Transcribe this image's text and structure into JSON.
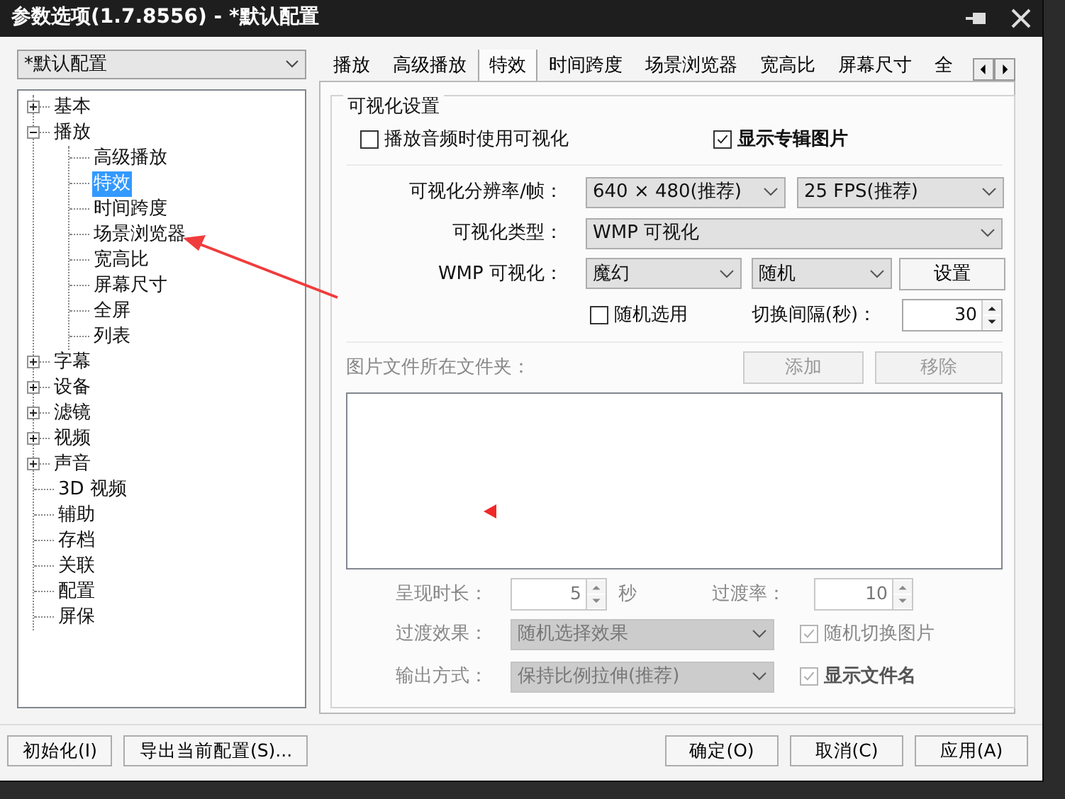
{
  "window": {
    "title": "参数选项(1.7.8556) - *默认配置"
  },
  "profile_select": {
    "value": "*默认配置"
  },
  "tree": [
    {
      "label": "基本",
      "expanded": false,
      "selected": false
    },
    {
      "label": "播放",
      "expanded": true,
      "selected": false,
      "children": [
        {
          "label": "高级播放",
          "selected": false
        },
        {
          "label": "特效",
          "selected": true
        },
        {
          "label": "时间跨度",
          "selected": false
        },
        {
          "label": "场景浏览器",
          "selected": false
        },
        {
          "label": "宽高比",
          "selected": false
        },
        {
          "label": "屏幕尺寸",
          "selected": false
        },
        {
          "label": "全屏",
          "selected": false
        },
        {
          "label": "列表",
          "selected": false
        }
      ]
    },
    {
      "label": "字幕",
      "expanded": false,
      "selected": false
    },
    {
      "label": "设备",
      "expanded": false,
      "selected": false
    },
    {
      "label": "滤镜",
      "expanded": false,
      "selected": false
    },
    {
      "label": "视频",
      "expanded": false,
      "selected": false
    },
    {
      "label": "声音",
      "expanded": false,
      "selected": false
    },
    {
      "label": "3D 视频",
      "selected": false
    },
    {
      "label": "辅助",
      "selected": false
    },
    {
      "label": "存档",
      "selected": false
    },
    {
      "label": "关联",
      "selected": false
    },
    {
      "label": "配置",
      "selected": false
    },
    {
      "label": "屏保",
      "selected": false
    }
  ],
  "tabs": [
    {
      "label": "播放",
      "selected": false
    },
    {
      "label": "高级播放",
      "selected": false
    },
    {
      "label": "特效",
      "selected": true
    },
    {
      "label": "时间跨度",
      "selected": false
    },
    {
      "label": "场景浏览器",
      "selected": false
    },
    {
      "label": "宽高比",
      "selected": false
    },
    {
      "label": "屏幕尺寸",
      "selected": false
    },
    {
      "label": "全",
      "selected": false
    }
  ],
  "group": {
    "title": "可视化设置",
    "use_visualization": {
      "label": "播放音频时使用可视化",
      "checked": false
    },
    "show_album_art": {
      "label": "显示专辑图片",
      "checked": true
    },
    "resolution": {
      "label": "可视化分辨率/帧：",
      "size": "640 × 480(推荐)",
      "fps": "25 FPS(推荐)"
    },
    "type": {
      "label": "可视化类型：",
      "value": "WMP 可视化"
    },
    "wmp": {
      "label": "WMP 可视化：",
      "preset": "魔幻",
      "mode": "随机",
      "button": "设置"
    },
    "random_pick": {
      "label": "随机选用",
      "checked": false
    },
    "interval": {
      "label": "切换间隔(秒)：",
      "value": "30"
    },
    "folder": {
      "label": "图片文件所在文件夹：",
      "disabled": true,
      "add": "添加",
      "remove": "移除"
    },
    "duration": {
      "label": "呈现时长：",
      "value": "5",
      "unit": "秒",
      "disabled": true
    },
    "rate": {
      "label": "过渡率：",
      "value": "10",
      "disabled": true
    },
    "effect": {
      "label": "过渡效果：",
      "value": "随机选择效果",
      "disabled": true
    },
    "shuffle": {
      "label": "随机切换图片",
      "checked": true,
      "disabled": true
    },
    "output": {
      "label": "输出方式：",
      "value": "保持比例拉伸(推荐)",
      "disabled": true
    },
    "show_filename": {
      "label": "显示文件名",
      "checked": true,
      "disabled": true
    }
  },
  "buttons_left": [
    "初始化(I)",
    "导出当前配置(S)..."
  ],
  "buttons_right": [
    "确定(O)",
    "取消(C)",
    "应用(A)"
  ]
}
